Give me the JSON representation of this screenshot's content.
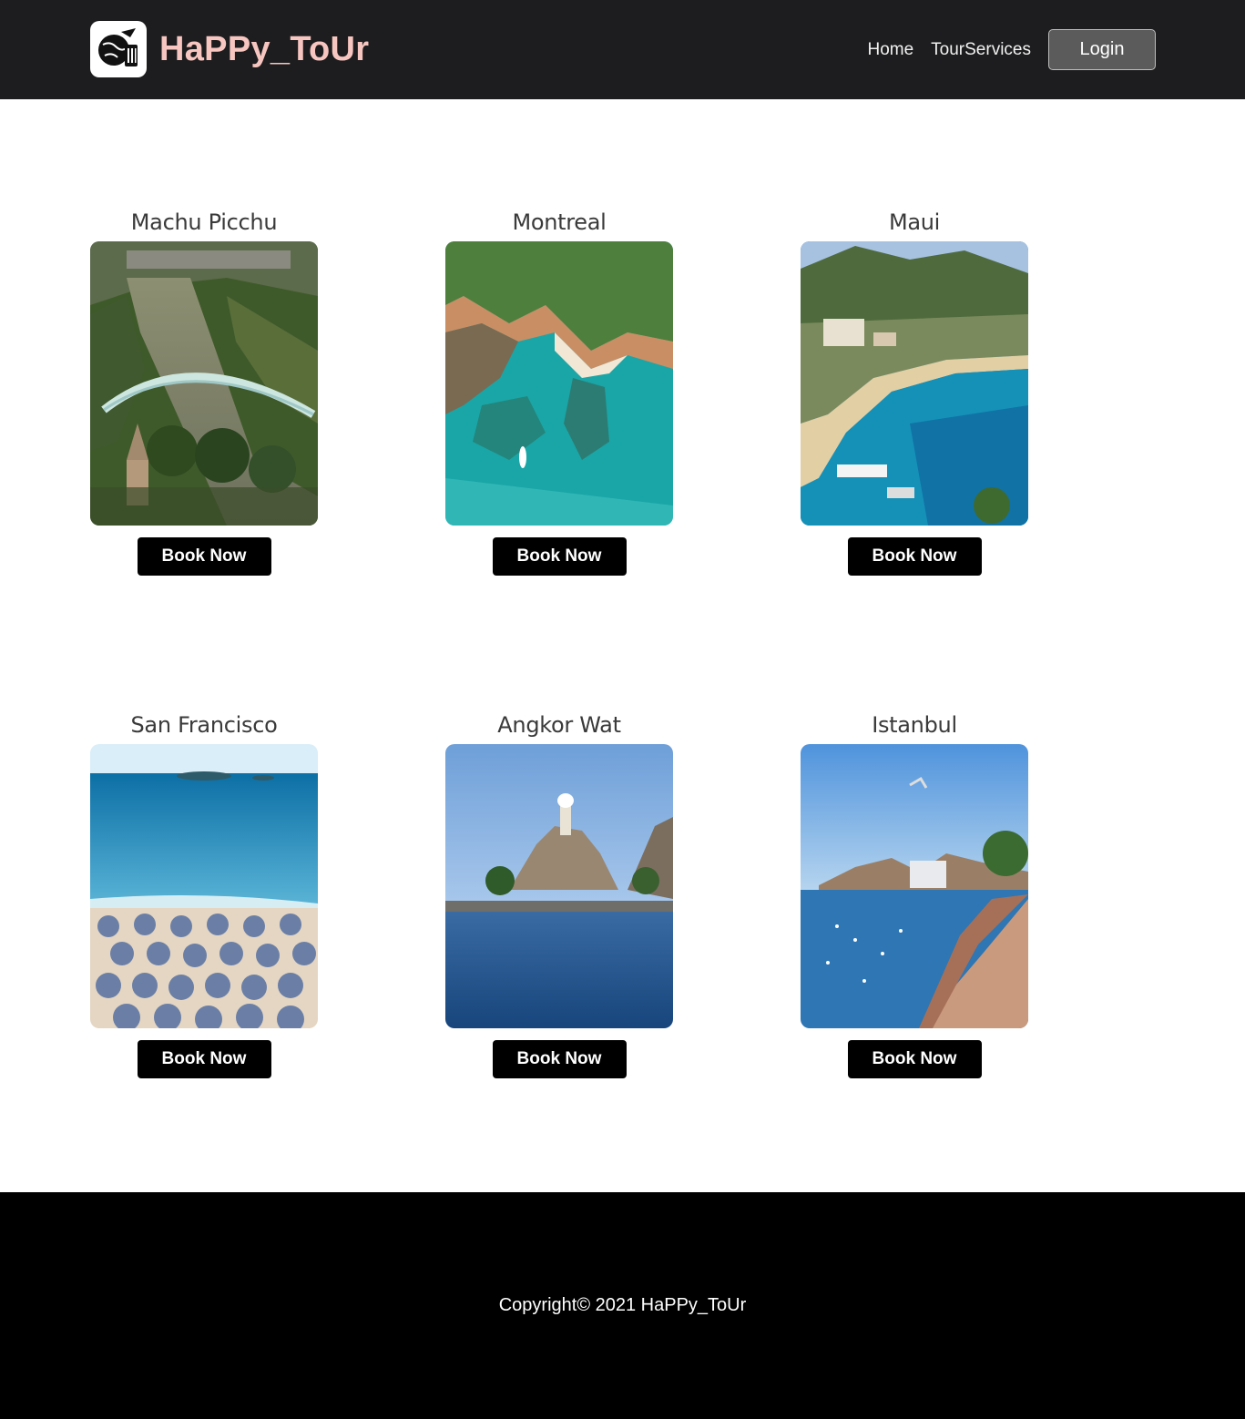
{
  "brand": {
    "name": "HaPPy_ToUr",
    "logo_icon": "travel-globe-icon",
    "brand_color": "#f7c6c0"
  },
  "nav": {
    "home": "Home",
    "services": "TourServices",
    "login": "Login"
  },
  "destinations": [
    {
      "title": "Machu Picchu",
      "button": "Book Now",
      "image": "river-bridge-photo"
    },
    {
      "title": "Montreal",
      "button": "Book Now",
      "image": "turquoise-cove-photo"
    },
    {
      "title": "Maui",
      "button": "Book Now",
      "image": "bay-beach-photo"
    },
    {
      "title": "San Francisco",
      "button": "Book Now",
      "image": "beach-umbrellas-photo"
    },
    {
      "title": "Angkor Wat",
      "button": "Book Now",
      "image": "coastal-fort-photo"
    },
    {
      "title": "Istanbul",
      "button": "Book Now",
      "image": "seaside-promenade-photo"
    }
  ],
  "footer": {
    "copyright": "Copyright© 2021 HaPPy_ToUr"
  },
  "colors": {
    "navbar": "#1d1d1f",
    "footer": "#000000",
    "button": "#000000"
  }
}
